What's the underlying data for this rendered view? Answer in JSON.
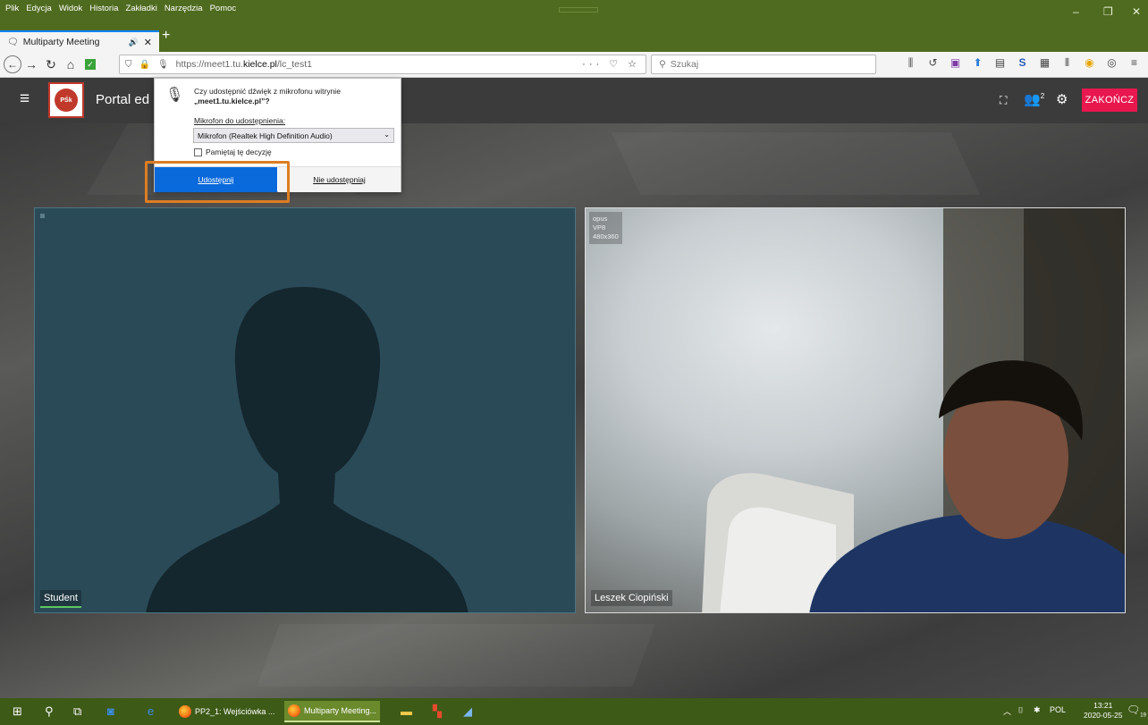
{
  "browser": {
    "menu": [
      "Plik",
      "Edycja",
      "Widok",
      "Historia",
      "Zakładki",
      "Narzędzia",
      "Pomoc"
    ],
    "tab_title": "Multiparty Meeting",
    "url_prefix": "https://meet1.tu.",
    "url_domain": "kielce.pl",
    "url_path": "/lc_test1",
    "url_actions": "··· ♡ ☆",
    "search_placeholder": "Szukaj"
  },
  "app": {
    "title": "Portal ed",
    "end_button": "ZAKOŃCZ",
    "participants_count": "2"
  },
  "popup": {
    "question_line1": "Czy udostępnić dźwięk z mikrofonu witrynie",
    "question_line2": "„meet1.tu.kielce.pl”?",
    "mic_label": "Mikrofon do udostępnienia:",
    "mic_selected": "Mikrofon (Realtek High Definition Audio)",
    "remember_label": "Pamiętaj tę decyzję",
    "share_button": "Udostępnij",
    "deny_button": "Nie udostępniaj"
  },
  "videos": {
    "left_name": "Student",
    "right_name": "Leszek Ciopiński",
    "right_stats": [
      "opus",
      "VP8",
      "480x360"
    ]
  },
  "taskbar": {
    "app1": "PP2_1: Wejściówka ...",
    "app2": "Multiparty Meeting...",
    "lang": "POL",
    "time": "13:21",
    "date": "2020-05-25",
    "notification_count": "19"
  },
  "colors": {
    "chrome_green": "#4f6b1f",
    "end_button": "#e8174e",
    "share_button": "#0a69db",
    "highlight": "#dd7d22"
  }
}
